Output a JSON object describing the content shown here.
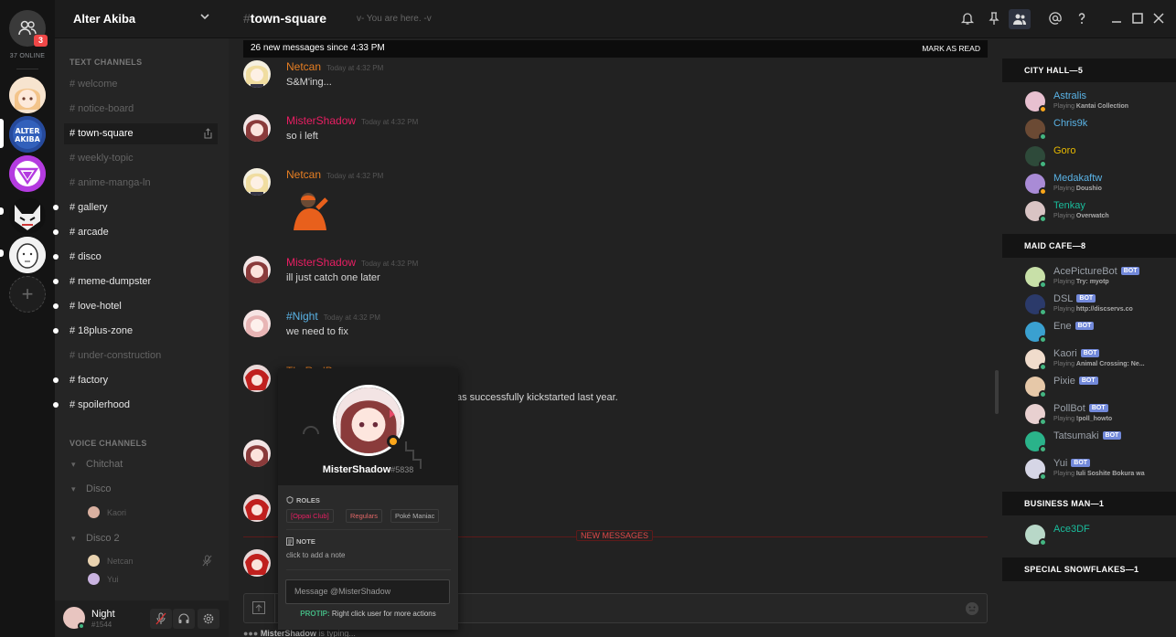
{
  "rail": {
    "badge": "3",
    "online": "37 ONLINE"
  },
  "guild": {
    "name": "Alter Akiba"
  },
  "text_channels": {
    "header": "TEXT CHANNELS",
    "items": [
      {
        "name": "welcome",
        "state": "muted"
      },
      {
        "name": "notice-board",
        "state": "muted"
      },
      {
        "name": "town-square",
        "state": "active"
      },
      {
        "name": "weekly-topic",
        "state": "muted"
      },
      {
        "name": "anime-manga-ln",
        "state": "muted"
      },
      {
        "name": "gallery",
        "state": "unread"
      },
      {
        "name": "arcade",
        "state": "unread"
      },
      {
        "name": "disco",
        "state": "unread"
      },
      {
        "name": "meme-dumpster",
        "state": "unread"
      },
      {
        "name": "love-hotel",
        "state": "unread"
      },
      {
        "name": "18plus-zone",
        "state": "unread"
      },
      {
        "name": "under-construction",
        "state": "muted"
      },
      {
        "name": "factory",
        "state": "unread"
      },
      {
        "name": "spoilerhood",
        "state": "unread"
      }
    ]
  },
  "voice_channels": {
    "header": "VOICE CHANNELS",
    "chitchat": "Chitchat",
    "disco": "Disco",
    "disco_user": "Kaori",
    "disco2": "Disco 2",
    "disco2_users": [
      "Netcan",
      "Yui"
    ]
  },
  "me": {
    "name": "Night",
    "tag": "#1544"
  },
  "channel": {
    "hash": "#",
    "name": "town-square",
    "topic": "v- You are here. -v"
  },
  "new_messages_bar": {
    "text": "26 new messages since 4:33 PM",
    "action": "MARK AS READ"
  },
  "messages": [
    {
      "author": "Netcan",
      "color": "#e67e22",
      "time": "Today at 4:32 PM",
      "text": "S&M'ing..."
    },
    {
      "author": "MisterShadow",
      "color": "#e91e63",
      "time": "Today at 4:32 PM",
      "text": "so i left"
    },
    {
      "author": "Netcan",
      "color": "#e67e22",
      "time": "Today at 4:32 PM",
      "text": ""
    },
    {
      "author": "MisterShadow",
      "color": "#e91e63",
      "time": "Today at 4:32 PM",
      "text": "ill just catch one later"
    },
    {
      "author": "#Night",
      "color": "#5ab3e6",
      "time": "Today at 4:32 PM",
      "text": "we need to fix"
    },
    {
      "author": "TheRedBaron",
      "color": "#e67e22",
      "time": "",
      "text": "as successfully kickstarted last year."
    }
  ],
  "new_divider": "NEW MESSAGES",
  "typing": {
    "user": "MisterShadow",
    "rest": " is typing..."
  },
  "popout": {
    "name": "MisterShadow",
    "discrim": "#5838",
    "roles_header": "ROLES",
    "roles": [
      {
        "name": "[Oppai Club]",
        "color": "#e91e63"
      },
      {
        "name": "Regulars",
        "color": "#e06666"
      },
      {
        "name": "Poké Maniac",
        "color": "#b0b0b0"
      }
    ],
    "note_header": "NOTE",
    "note": "click to add a note",
    "message_placeholder": "Message @MisterShadow",
    "protip_label": "PROTIP:",
    "protip": "Right click user for more actions"
  },
  "members": [
    {
      "header": "CITY HALL—5",
      "items": [
        {
          "name": "Astralis",
          "color": "#5ab3e6",
          "status": "idle",
          "playing": "Playing ",
          "game": "Kantai Collection",
          "bot": false
        },
        {
          "name": "Chris9k",
          "color": "#5ab3e6",
          "status": "online",
          "playing": "",
          "game": "",
          "bot": false
        },
        {
          "name": "Goro",
          "color": "#e6b800",
          "status": "online",
          "playing": "",
          "game": "",
          "bot": false
        },
        {
          "name": "Medakaftw",
          "color": "#5ab3e6",
          "status": "idle",
          "playing": "Playing ",
          "game": "Doushio",
          "bot": false
        },
        {
          "name": "Tenkay",
          "color": "#1abc9c",
          "status": "online",
          "playing": "Playing ",
          "game": "Overwatch",
          "bot": false
        }
      ]
    },
    {
      "header": "MAID CAFE—8",
      "items": [
        {
          "name": "AcePictureBot",
          "color": "#9aa0a8",
          "status": "online",
          "playing": "Playing ",
          "game": "Try: myotp",
          "bot": true
        },
        {
          "name": "DSL",
          "color": "#9aa0a8",
          "status": "online",
          "playing": "Playing ",
          "game": "http://discservs.co",
          "bot": true
        },
        {
          "name": "Ene",
          "color": "#9aa0a8",
          "status": "online",
          "playing": "",
          "game": "",
          "bot": true
        },
        {
          "name": "Kaori",
          "color": "#9aa0a8",
          "status": "online",
          "playing": "Playing ",
          "game": "Animal Crossing: Ne...",
          "bot": true
        },
        {
          "name": "Pixie",
          "color": "#9aa0a8",
          "status": "online",
          "playing": "",
          "game": "",
          "bot": true
        },
        {
          "name": "PollBot",
          "color": "#9aa0a8",
          "status": "online",
          "playing": "Playing ",
          "game": "!poll_howto",
          "bot": true
        },
        {
          "name": "Tatsumaki",
          "color": "#9aa0a8",
          "status": "online",
          "playing": "",
          "game": "",
          "bot": true
        },
        {
          "name": "Yui",
          "color": "#9aa0a8",
          "status": "online",
          "playing": "Playing ",
          "game": "Iuli Soshite Bokura wa",
          "bot": true
        }
      ]
    },
    {
      "header": "BUSINESS MAN—1",
      "items": [
        {
          "name": "Ace3DF",
          "color": "#1abc9c",
          "status": "online",
          "playing": "",
          "game": "",
          "bot": false
        }
      ]
    },
    {
      "header": "SPECIAL SNOWFLAKES—1",
      "items": []
    }
  ],
  "bot_label": "BOT",
  "colors": {
    "accent": "#7289da",
    "online": "#43b581",
    "idle": "#faa61a",
    "alert": "#f04747"
  }
}
